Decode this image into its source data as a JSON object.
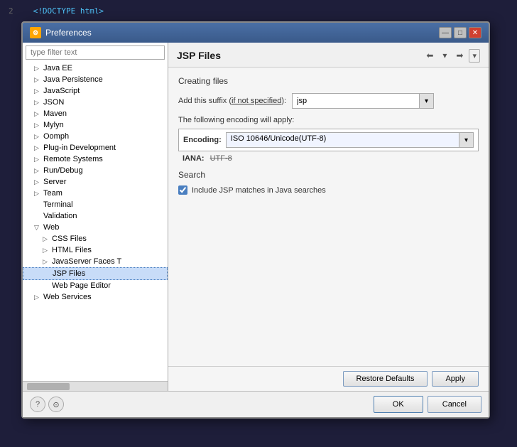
{
  "background_code": {
    "lines": [
      {
        "num": "2",
        "text": "<!DOCTYPE html>"
      },
      {
        "num": "",
        "text": ""
      }
    ]
  },
  "dialog": {
    "title": "Preferences",
    "title_icon": "⚙",
    "filter_placeholder": "type filter text",
    "content_title": "JSP Files",
    "tree": {
      "items": [
        {
          "label": "Java EE",
          "indent": 1,
          "has_arrow": true,
          "selected": false
        },
        {
          "label": "Java Persistence",
          "indent": 1,
          "has_arrow": true,
          "selected": false
        },
        {
          "label": "JavaScript",
          "indent": 1,
          "has_arrow": true,
          "selected": false
        },
        {
          "label": "JSON",
          "indent": 1,
          "has_arrow": true,
          "selected": false
        },
        {
          "label": "Maven",
          "indent": 1,
          "has_arrow": true,
          "selected": false
        },
        {
          "label": "Mylyn",
          "indent": 1,
          "has_arrow": true,
          "selected": false
        },
        {
          "label": "Oomph",
          "indent": 1,
          "has_arrow": true,
          "selected": false
        },
        {
          "label": "Plug-in Development",
          "indent": 1,
          "has_arrow": true,
          "selected": false
        },
        {
          "label": "Remote Systems",
          "indent": 1,
          "has_arrow": true,
          "selected": false
        },
        {
          "label": "Run/Debug",
          "indent": 1,
          "has_arrow": true,
          "selected": false
        },
        {
          "label": "Server",
          "indent": 1,
          "has_arrow": true,
          "selected": false
        },
        {
          "label": "Team",
          "indent": 1,
          "has_arrow": true,
          "selected": false
        },
        {
          "label": "Terminal",
          "indent": 1,
          "has_arrow": false,
          "selected": false
        },
        {
          "label": "Validation",
          "indent": 1,
          "has_arrow": false,
          "selected": false
        },
        {
          "label": "Web",
          "indent": 1,
          "has_arrow": true,
          "expanded": true,
          "selected": false
        },
        {
          "label": "CSS Files",
          "indent": 2,
          "has_arrow": true,
          "selected": false
        },
        {
          "label": "HTML Files",
          "indent": 2,
          "has_arrow": true,
          "selected": false
        },
        {
          "label": "JavaServer Faces T",
          "indent": 2,
          "has_arrow": true,
          "selected": false
        },
        {
          "label": "JSP Files",
          "indent": 2,
          "has_arrow": false,
          "selected": true
        },
        {
          "label": "Web Page Editor",
          "indent": 2,
          "has_arrow": false,
          "selected": false
        },
        {
          "label": "Web Services",
          "indent": 1,
          "has_arrow": true,
          "selected": false
        }
      ]
    },
    "creating_files": {
      "section_label": "Creating files",
      "suffix_label": "Add this suffix (if not specified):",
      "suffix_underline": "if not specified",
      "suffix_value": "jsp",
      "encoding_note": "The following encoding will apply:",
      "encoding_label": "Encoding:",
      "encoding_value": "ISO 10646/Unicode(UTF-8)",
      "iana_label": "IANA:",
      "iana_value": "UTF-8"
    },
    "search": {
      "section_label": "Search",
      "checkbox_label": "Include JSP matches in Java searches",
      "checkbox_checked": true
    },
    "buttons": {
      "restore_defaults": "Restore Defaults",
      "apply": "Apply",
      "ok": "OK",
      "cancel": "Cancel"
    },
    "title_buttons": {
      "minimize": "—",
      "maximize": "□",
      "close": "✕"
    }
  }
}
